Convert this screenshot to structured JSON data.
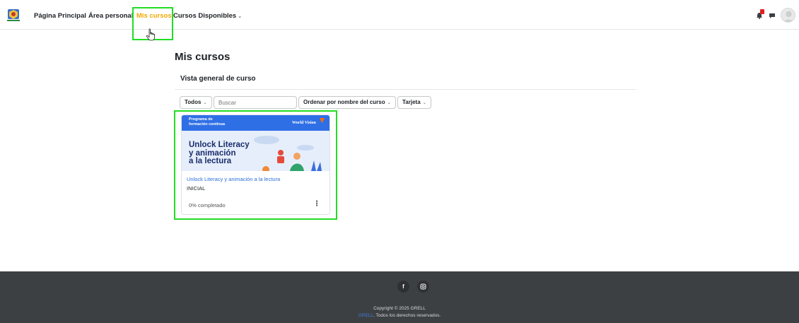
{
  "nav": {
    "home": "Página Principal",
    "personal_area": "Área personal",
    "my_courses": "Mis cursos",
    "available_courses": "Cursos Disponibles"
  },
  "main": {
    "title": "Mis cursos",
    "section_title": "Vista general de curso"
  },
  "filters": {
    "all": "Todos",
    "search_placeholder": "Buscar",
    "sort": "Ordenar por nombre del curso",
    "view": "Tarjeta"
  },
  "course": {
    "banner_line1": "Programa de",
    "banner_line2": "formación continua",
    "banner_brand": "World Vision",
    "banner_title_1": "Unlock Literacy",
    "banner_title_2": "y animación",
    "banner_title_3": "a la lectura",
    "name": "Unlock Literacy y animación a la lectura",
    "category": "INICIAL",
    "progress_text": "0% completado",
    "progress_percent": 0
  },
  "footer": {
    "copyright": "Copyright © 2025 GRELL",
    "brand_link": "GRELL",
    "rights": ". Todos los derechos reservados."
  },
  "colors": {
    "accent_active_nav": "#f2a900",
    "highlight": "#22dd22",
    "link": "#2a6fd6",
    "footer_bg": "#3d4043"
  },
  "icons": [
    "logo-emblem",
    "bell-icon",
    "chat-icon",
    "avatar",
    "facebook-icon",
    "instagram-icon",
    "kebab-menu-icon",
    "hand-cursor"
  ]
}
